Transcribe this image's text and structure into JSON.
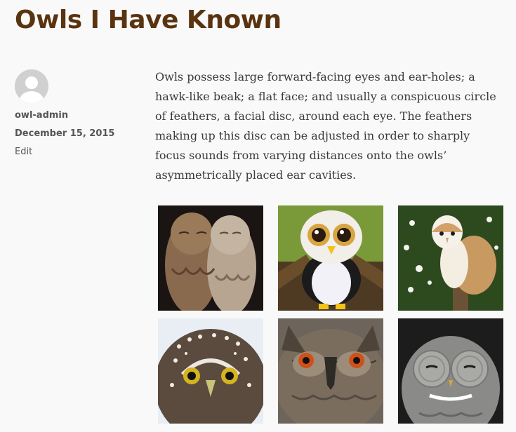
{
  "post": {
    "title": "Owls I Have Known",
    "author": "owl-admin",
    "date": "December 15, 2015",
    "edit_label": "Edit",
    "body": "Owls possess large forward-facing eyes and ear-holes; a hawk-like beak; a flat face; and usually a conspicuous circle of feathers, a facial disc, around each eye. The feathers making up this disc can be adjusted in order to sharply focus sounds from varying distances onto the owls’ asymmetrically placed ear cavities."
  },
  "gallery": {
    "images": [
      {
        "name": "tawny-owls-pair-photo"
      },
      {
        "name": "plush-owl-toy-photo"
      },
      {
        "name": "barn-owl-on-post-photo"
      },
      {
        "name": "pygmy-owl-closeup-photo"
      },
      {
        "name": "eagle-owl-closeup-photo"
      },
      {
        "name": "great-grey-owl-closeup-photo"
      }
    ]
  },
  "colors": {
    "title": "#5a3410",
    "background": "#f9f9f9",
    "body_text": "#3a3a3a",
    "meta_text": "#555555"
  }
}
